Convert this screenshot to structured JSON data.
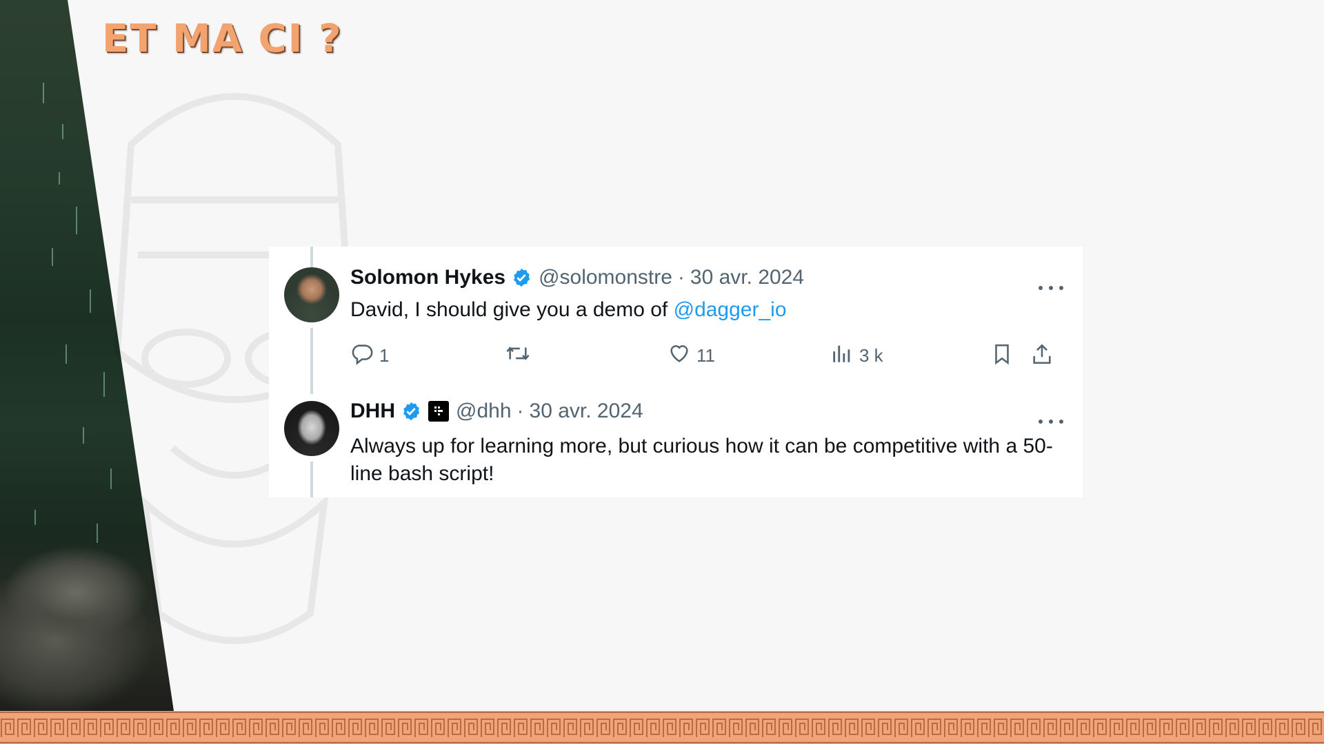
{
  "slide": {
    "title": "ET MA CI ?"
  },
  "tweets": [
    {
      "author": "Solomon Hykes",
      "verified": true,
      "handle": "@solomonstre",
      "separator": "·",
      "date": "30 avr. 2024",
      "text": "David, I should give you a demo of ",
      "mention": "@dagger_io",
      "replies": "1",
      "likes": "11",
      "views": "3 k"
    },
    {
      "author": "DHH",
      "verified": true,
      "handle": "@dhh",
      "separator": "·",
      "date": "30 avr. 2024",
      "text": "Always up for learning more, but curious how it can be competitive with a 50-line bash script!"
    }
  ],
  "colors": {
    "accent": "#1d9bf0",
    "title": "#f2a370",
    "border": "#f0a478",
    "muted": "#536471"
  },
  "icons": [
    "reply-icon",
    "retweet-icon",
    "like-icon",
    "views-icon",
    "bookmark-icon",
    "share-icon",
    "more-icon",
    "verified-icon"
  ]
}
